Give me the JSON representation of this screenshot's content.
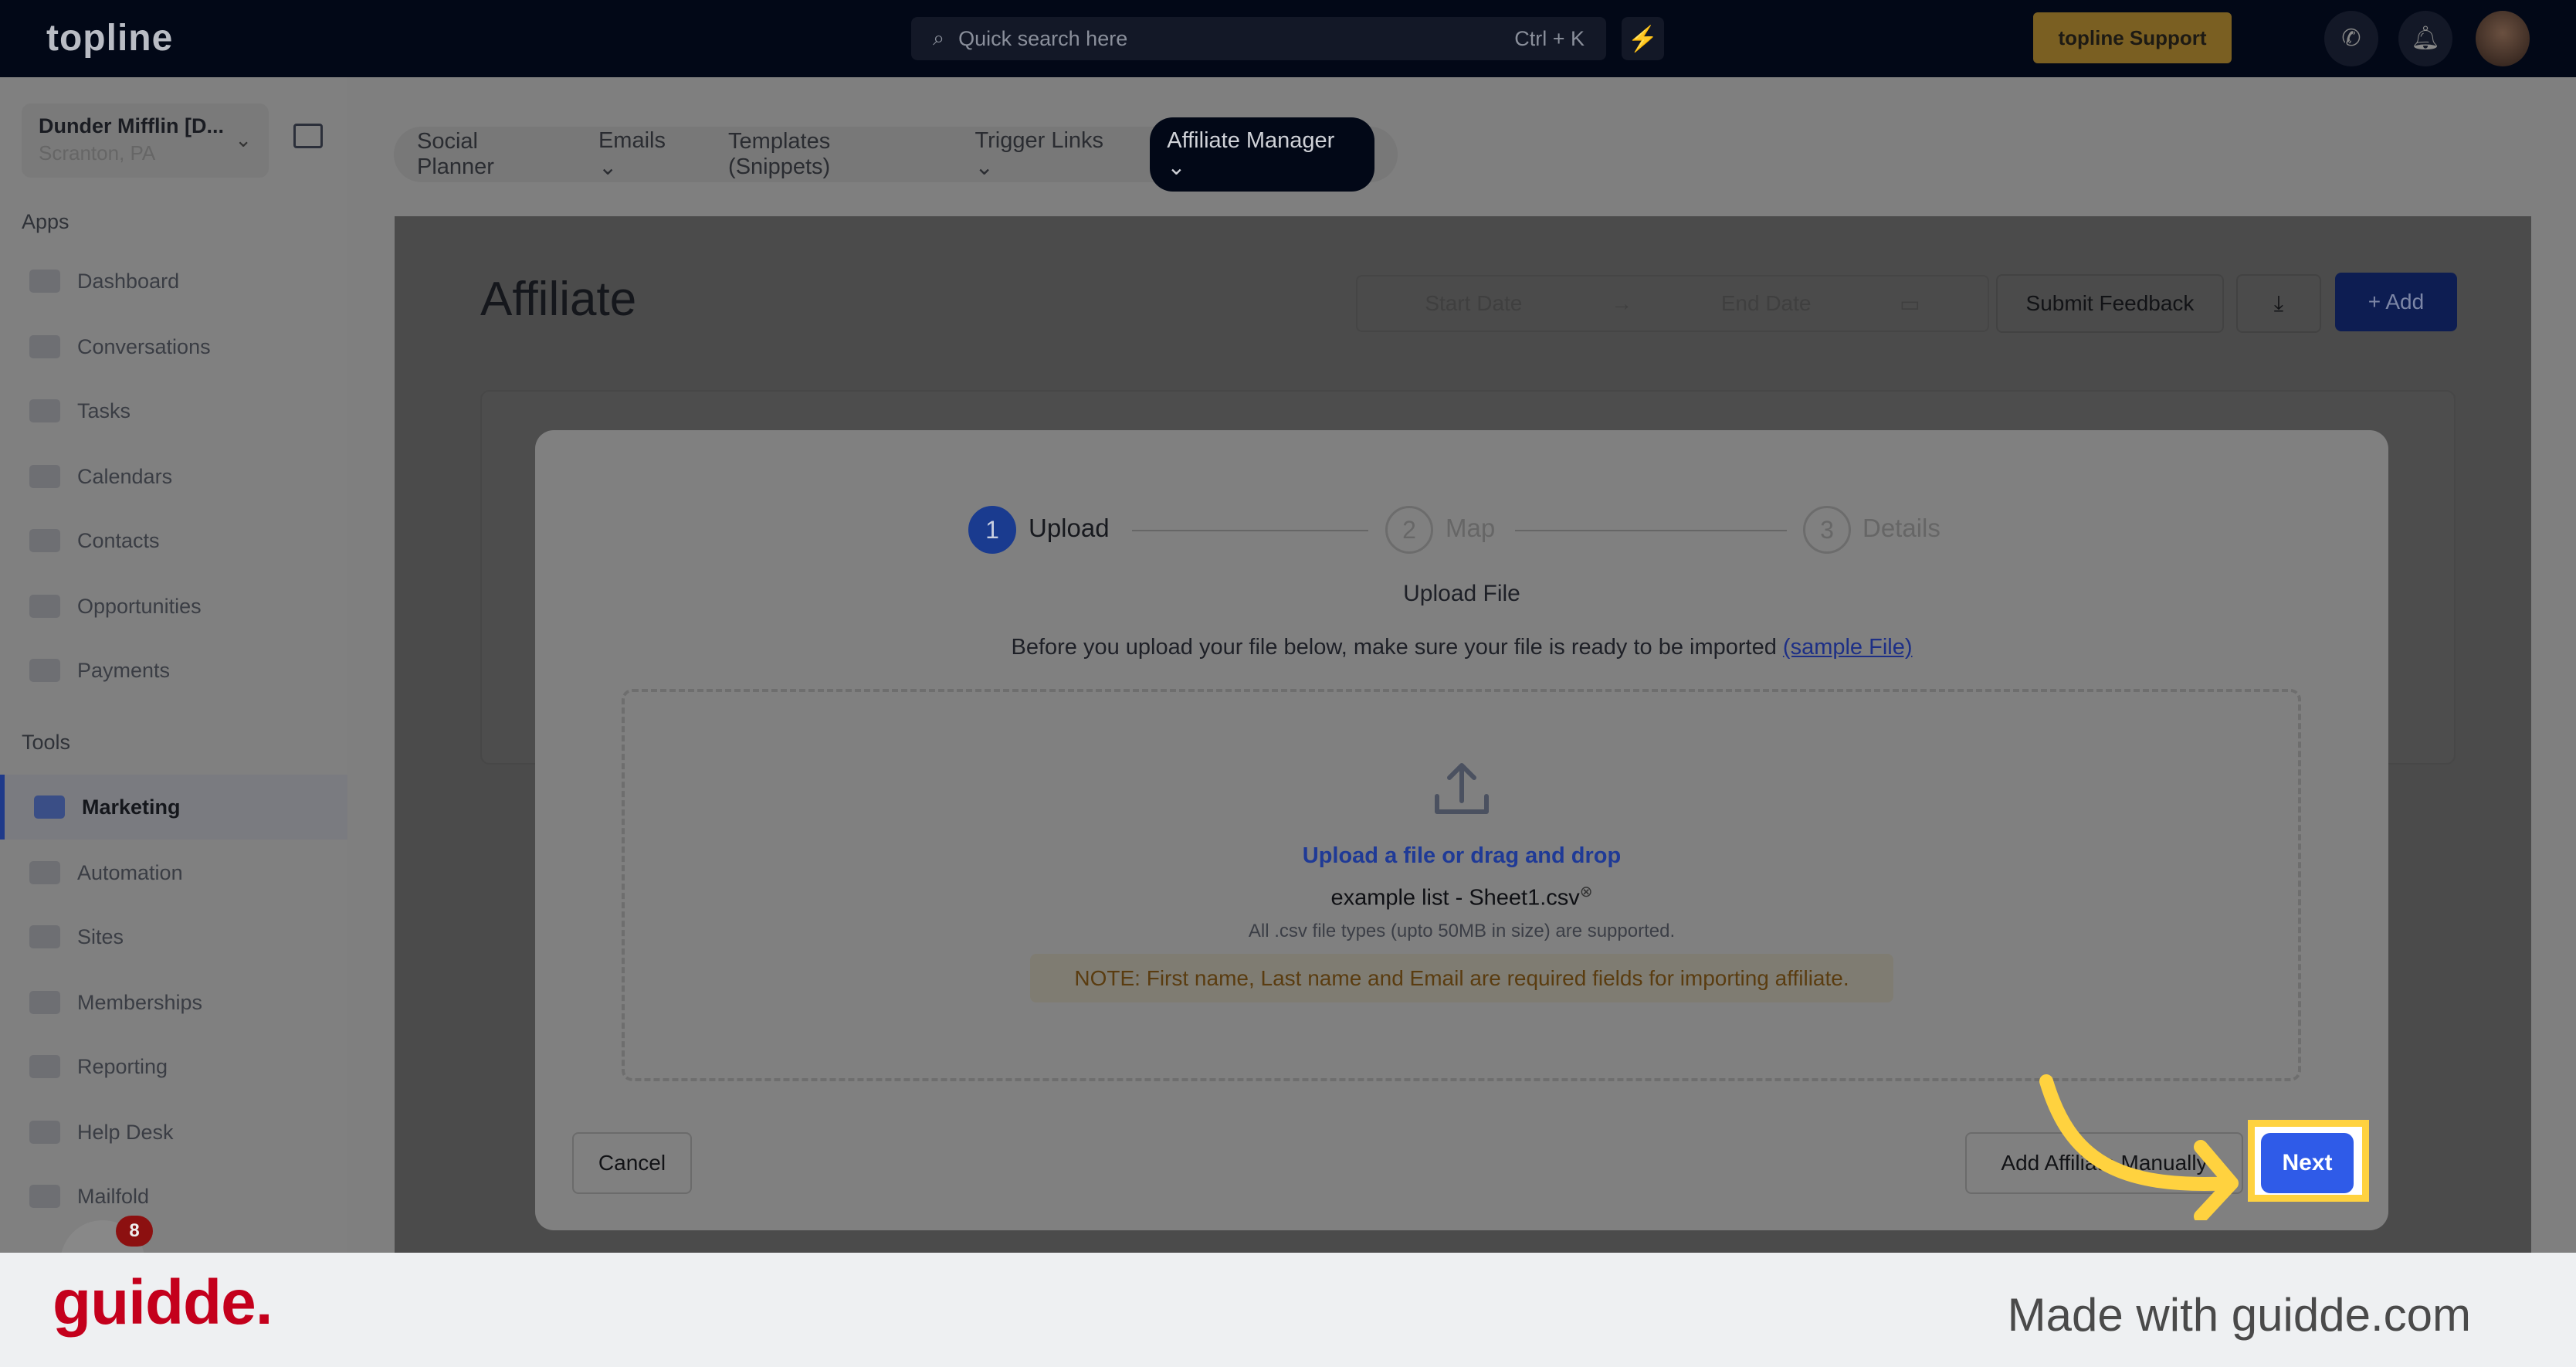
{
  "header": {
    "logo": "topline",
    "search_placeholder": "Quick search here",
    "search_shortcut": "Ctrl + K",
    "support_label": "topline Support"
  },
  "account": {
    "name": "Dunder Mifflin [D...",
    "location": "Scranton, PA"
  },
  "sidebar": {
    "apps_label": "Apps",
    "tools_label": "Tools",
    "apps": [
      {
        "label": "Dashboard"
      },
      {
        "label": "Conversations"
      },
      {
        "label": "Tasks"
      },
      {
        "label": "Calendars"
      },
      {
        "label": "Contacts"
      },
      {
        "label": "Opportunities"
      },
      {
        "label": "Payments"
      }
    ],
    "tools": [
      {
        "label": "Marketing",
        "active": true
      },
      {
        "label": "Automation"
      },
      {
        "label": "Sites"
      },
      {
        "label": "Memberships"
      },
      {
        "label": "Reporting"
      },
      {
        "label": "Help Desk"
      },
      {
        "label": "Mailfold"
      }
    ],
    "chat_badge": "8"
  },
  "topnav": [
    {
      "label": "Social Planner"
    },
    {
      "label": "Emails ⌄"
    },
    {
      "label": "Templates (Snippets)"
    },
    {
      "label": "Trigger Links ⌄"
    },
    {
      "label": "Affiliate Manager ⌄",
      "active": true
    }
  ],
  "page": {
    "title": "Affiliate",
    "start_date": "Start Date",
    "end_date": "End Date",
    "submit_feedback": "Submit Feedback",
    "add": "+ Add"
  },
  "modal": {
    "steps": [
      {
        "num": "1",
        "label": "Upload",
        "active": true
      },
      {
        "num": "2",
        "label": "Map"
      },
      {
        "num": "3",
        "label": "Details"
      }
    ],
    "heading": "Upload File",
    "intro": "Before you upload your file below, make sure your file is ready to be imported",
    "sample_link": "(sample File)",
    "upload_link": "Upload a file or drag and drop",
    "file_name": "example list - Sheet1.csv",
    "supported": "All .csv file types (upto 50MB in size) are supported.",
    "note": "NOTE: First name, Last name and Email are required fields for importing affiliate.",
    "cancel": "Cancel",
    "add_manually": "Add Affiliate Manually",
    "next": "Next"
  },
  "colors": {
    "header": "#020817",
    "primary": "#2f5be8",
    "highlight": "#ffd23f",
    "guidde": "#c4001c"
  },
  "footer": {
    "logo": "guidde.",
    "made_with": "Made with guidde.com"
  }
}
